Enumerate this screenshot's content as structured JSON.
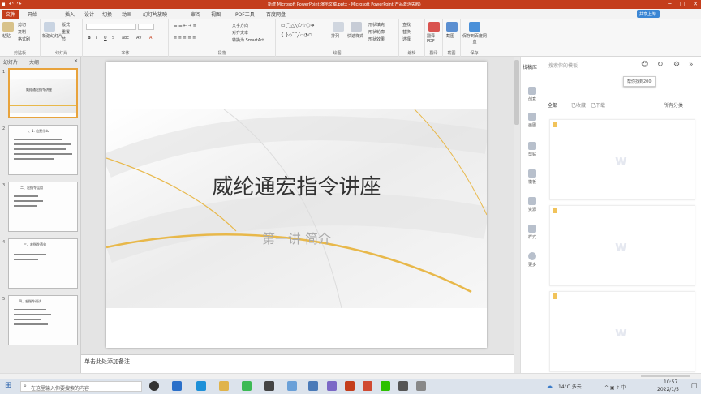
{
  "window": {
    "title": "新建 Microsoft PowerPoint 演示文稿.pptx - Microsoft PowerPoint(产品激活失败)",
    "share_label": "共享上传"
  },
  "tabs": [
    "文件",
    "开始",
    "插入",
    "设计",
    "切换",
    "动画",
    "幻灯片放映",
    "审阅",
    "视图",
    "PDF工具",
    "百度网盘"
  ],
  "ribbon": {
    "groups": [
      {
        "label": "剪贴板",
        "buttons": [
          "粘贴",
          "剪切",
          "复制",
          "格式刷"
        ]
      },
      {
        "label": "幻灯片",
        "buttons": [
          "新建幻灯片",
          "版式",
          "重置",
          "节"
        ]
      },
      {
        "label": "字体",
        "buttons": []
      },
      {
        "label": "段落",
        "buttons": [
          "文字方向",
          "对齐文本",
          "转换为 SmartArt"
        ]
      },
      {
        "label": "绘图",
        "buttons": [
          "排列",
          "快速样式",
          "形状填充",
          "形状轮廓",
          "形状效果"
        ]
      },
      {
        "label": "编辑",
        "buttons": [
          "查找",
          "替换",
          "选择"
        ]
      },
      {
        "label": "翻译",
        "buttons": [
          "翻译PDF"
        ]
      },
      {
        "label": "截图",
        "buttons": [
          "截图"
        ]
      },
      {
        "label": "保存",
        "buttons": [
          "保存到百度网盘"
        ]
      }
    ]
  },
  "left_pane": {
    "tabs": [
      "幻灯片",
      "大纲"
    ],
    "thumbnails": [
      {
        "num": "1",
        "title": "威纶通宏指令讲座",
        "selected": true
      },
      {
        "num": "2",
        "title": "一、1. 宏是什么",
        "selected": false
      },
      {
        "num": "3",
        "title": "二、宏指令运用",
        "selected": false
      },
      {
        "num": "4",
        "title": "三、宏指令语句",
        "selected": false
      },
      {
        "num": "5",
        "title": "四、宏指令调试",
        "selected": false
      }
    ]
  },
  "slide": {
    "title": "威纶通宏指令讲座",
    "subtitle": "第一讲 简介"
  },
  "notes": {
    "placeholder": "单击此处添加备注"
  },
  "side_panel": {
    "title": "找稿库",
    "search_placeholder": "搜索你的模板",
    "tooltip": "帮你找到200",
    "filters": [
      "全部",
      "已收藏",
      "已下载",
      "所有分类"
    ],
    "nav": [
      "创意",
      "画图",
      "剪贴",
      "模板",
      "资源",
      "样式",
      "更多"
    ]
  },
  "taskbar": {
    "search_placeholder": "在这里输入你要搜索的内容",
    "weather": "14°C 多云",
    "time": "10:57",
    "date": "2022/1/5"
  },
  "colors": {
    "accent": "#c43e1c",
    "gold": "#e8b84a"
  }
}
